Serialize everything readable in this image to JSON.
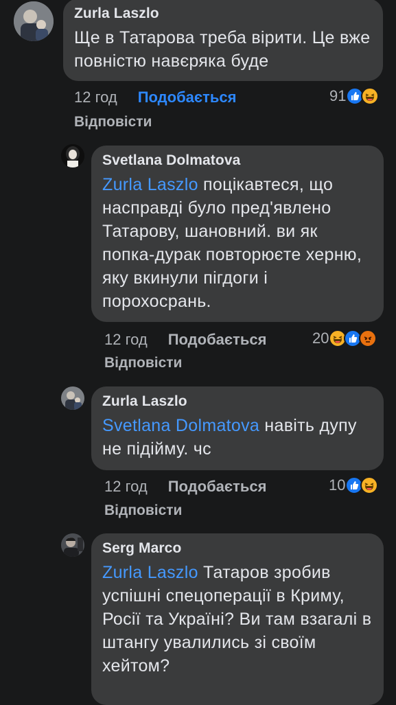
{
  "comments": [
    {
      "author": "Zurla Laszlo",
      "mention": "",
      "text": "Ще в Татарова треба вірити. Це вже повністю навєряка буде",
      "time": "12 год",
      "like_label": "Подобається",
      "like_active": true,
      "reply_label": "Відповісти",
      "reaction_count": "91",
      "reactions": [
        "like",
        "haha"
      ]
    },
    {
      "author": "Svetlana Dolmatova",
      "mention": "Zurla Laszlo",
      "text": "поцікавтеся, що насправді було пред'явлено Татарову, шановний. ви як попка-дурак повторюєте херню, яку вкинули пігдоги і порохосрань.",
      "time": "12 год",
      "like_label": "Подобається",
      "like_active": false,
      "reply_label": "Відповісти",
      "reaction_count": "20",
      "reactions": [
        "haha",
        "like",
        "angry"
      ]
    },
    {
      "author": "Zurla Laszlo",
      "mention": "Svetlana Dolmatova",
      "text": "навіть дупу не підійму. чс",
      "time": "12 год",
      "like_label": "Подобається",
      "like_active": false,
      "reply_label": "Відповісти",
      "reaction_count": "10",
      "reactions": [
        "like",
        "haha"
      ]
    },
    {
      "author": "Serg Marco",
      "mention": "Zurla Laszlo",
      "text": "Татаров зробив успішні спецоперації в Криму, Росії та Україні? Ви там взагалі в штангу увалились зі своїм хейтом?",
      "time": "",
      "like_label": "",
      "like_active": false,
      "reply_label": "",
      "reaction_count": "",
      "reactions": []
    }
  ],
  "colors": {
    "background": "#18191a",
    "bubble": "#3a3b3c",
    "mention": "#4599ff",
    "like_active": "#2d88ff",
    "meta_text": "#b0b3b8"
  }
}
